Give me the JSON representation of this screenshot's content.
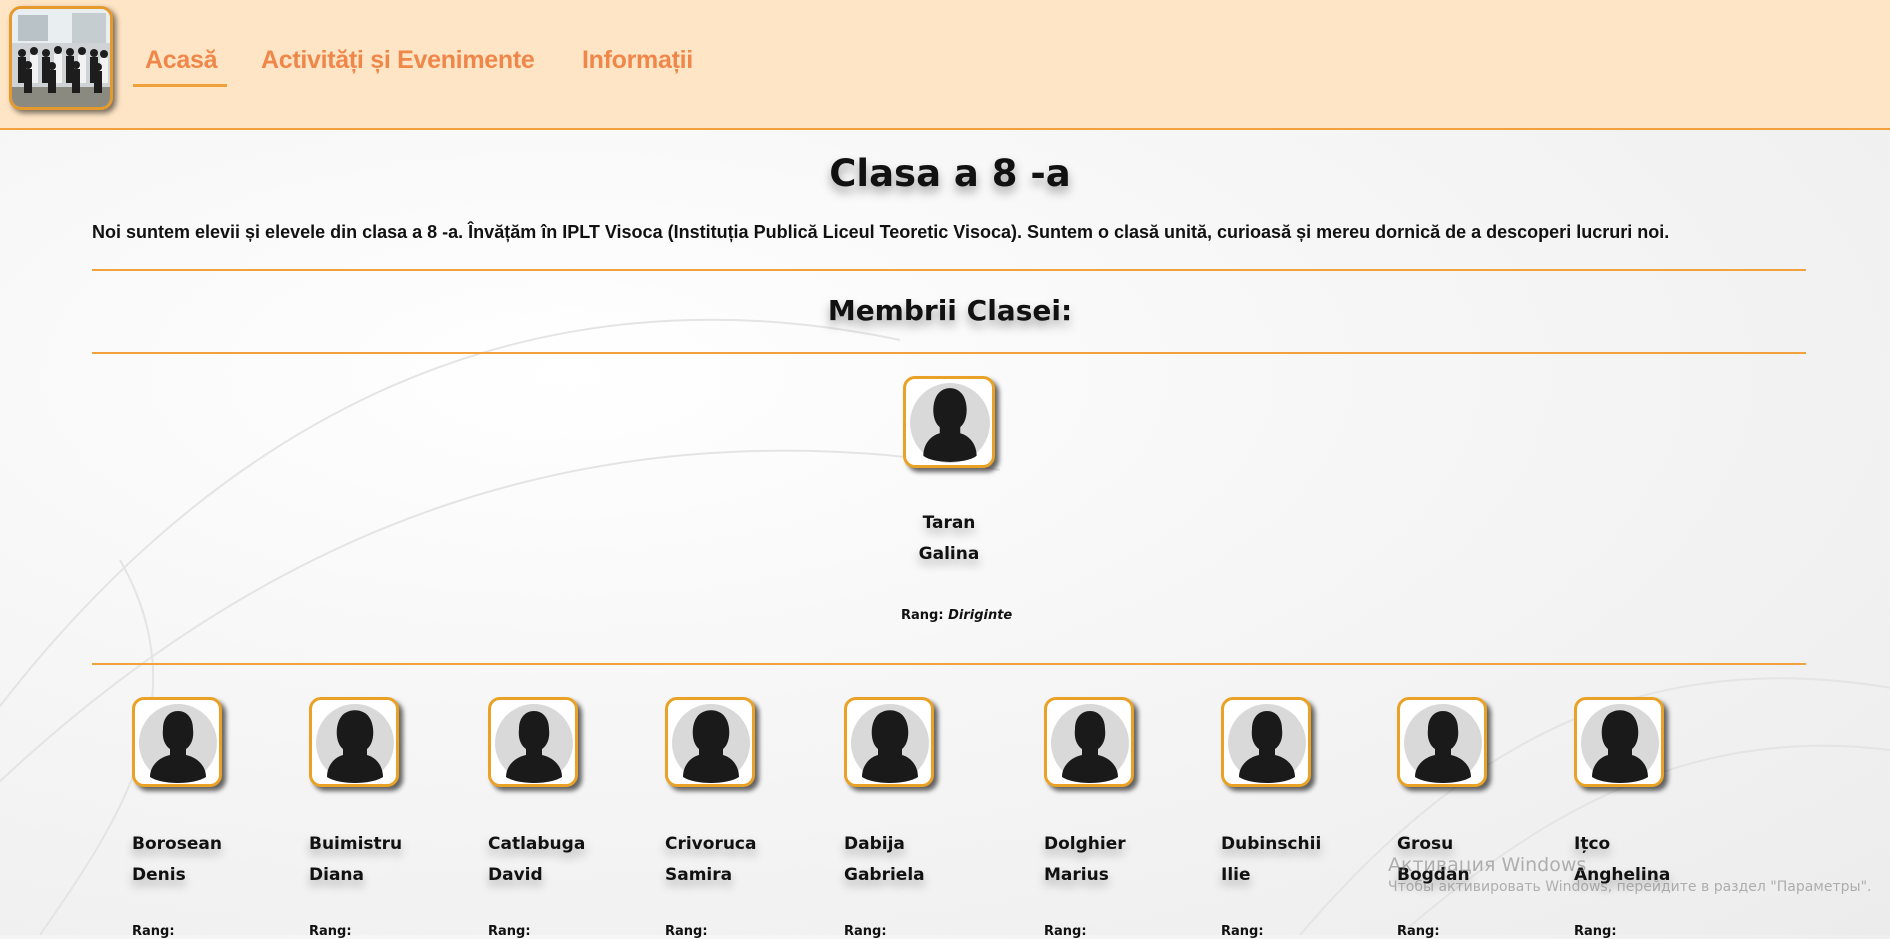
{
  "nav": {
    "items": [
      {
        "label": "Acasă",
        "active": true
      },
      {
        "label": "Activități și Evenimente",
        "active": false
      },
      {
        "label": "Informații",
        "active": false
      }
    ]
  },
  "main": {
    "title": "Clasa a 8 -a",
    "intro": "Noi suntem elevii și elevele din clasa a 8 -a. Învățăm în IPLT Visoca (Instituția Publică Liceul Teoretic Visoca). Suntem o clasă unită, curioasă și mereu dornică de a descoperi lucruri noi.",
    "members_heading": "Membrii Clasei:"
  },
  "teacher": {
    "first": "Taran",
    "second": "Galina",
    "rank_label": "Rang:",
    "rank_value": "Diriginte",
    "avatar_icon": "female-avatar-icon"
  },
  "students": [
    {
      "first": "Borosean",
      "second": "Denis",
      "avatar_icon": "male-avatar-icon"
    },
    {
      "first": "Buimistru",
      "second": "Diana",
      "avatar_icon": "female-avatar-icon"
    },
    {
      "first": "Catlabuga",
      "second": "David",
      "avatar_icon": "male-avatar-icon"
    },
    {
      "first": "Crivoruca",
      "second": "Samira",
      "avatar_icon": "female-avatar-icon"
    },
    {
      "first": "Dabija",
      "second": "Gabriela",
      "avatar_icon": "female-avatar-icon"
    },
    {
      "first": "Dolghier",
      "second": "Marius",
      "avatar_icon": "male-avatar-icon"
    },
    {
      "first": "Dubinschii",
      "second": "Ilie",
      "avatar_icon": "male-avatar-icon"
    },
    {
      "first": "Grosu",
      "second": "Bogdan",
      "avatar_icon": "male-avatar-icon"
    },
    {
      "first": "Ițco",
      "second": "Anghelina",
      "avatar_icon": "female-avatar-icon"
    }
  ],
  "overlay": {
    "line1": "Активация Windows",
    "line2": "Чтобы активировать Windows, перейдите в раздел \"Параметры\"."
  },
  "colors": {
    "header_bg": "#fee5c5",
    "accent": "#f2a23c",
    "nav_text": "#f0874a"
  }
}
